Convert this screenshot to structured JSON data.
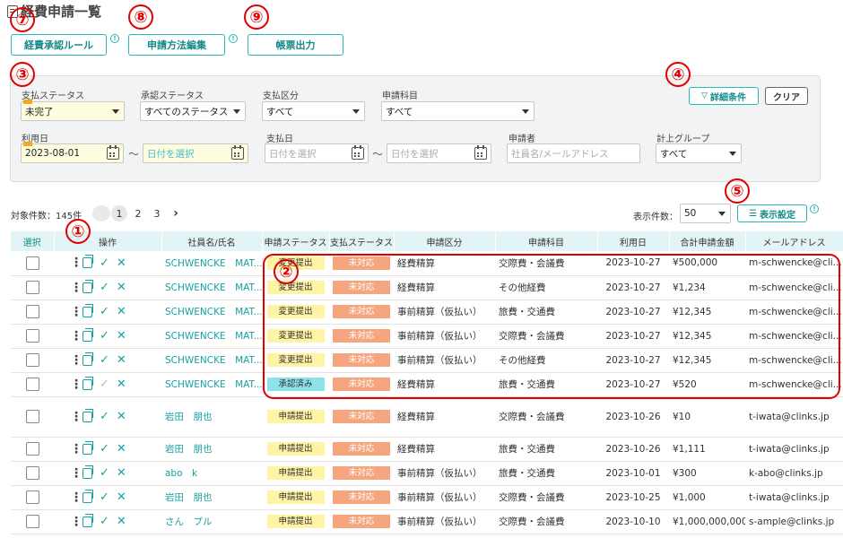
{
  "page": {
    "title": "経費申請一覧"
  },
  "toolbar": {
    "approval_rule": "経費承認ルール",
    "method_edit": "申請方法編集",
    "report_output": "帳票出力",
    "info": "!"
  },
  "callouts": [
    "①",
    "②",
    "③",
    "④",
    "⑤",
    "⑦",
    "⑧",
    "⑨"
  ],
  "filters": {
    "payment_status": {
      "label": "支払ステータス",
      "value": "未完了"
    },
    "approval_status": {
      "label": "承認ステータス",
      "value": "すべてのステータス"
    },
    "payment_type": {
      "label": "支払区分",
      "value": "すべて"
    },
    "item": {
      "label": "申請科目",
      "value": "すべて"
    },
    "use_date": {
      "label": "利用日",
      "from": "2023-08-01",
      "to_placeholder": "日付を選択"
    },
    "payment_date": {
      "label": "支払日",
      "from_placeholder": "日付を選択",
      "to_placeholder": "日付を選択"
    },
    "applicant": {
      "label": "申請者",
      "placeholder": "社員名/メールアドレス"
    },
    "group": {
      "label": "計上グループ",
      "value": "すべて"
    },
    "tilde": "～",
    "detail_button": "詳細条件",
    "clear_button": "クリア"
  },
  "list": {
    "count_text": "対象件数：145件",
    "pages": [
      "1",
      "2",
      "3"
    ],
    "next": "›",
    "page_size_label": "表示件数：",
    "page_size": "50",
    "display_settings": "表示設定"
  },
  "table": {
    "headers": [
      "選択",
      "操作",
      "社員名/氏名",
      "申請ステータス",
      "支払ステータス",
      "申請区分",
      "申請科目",
      "利用日",
      "合計申請金額",
      "メールアドレス"
    ],
    "rows": [
      {
        "name": "SCHWENCKE　MAT...",
        "status": "変更提出",
        "status_color": "y",
        "pay": "未対応",
        "type": "経費精算",
        "item": "交際費・会議費",
        "date": "2023-10-27",
        "amount": "¥500,000",
        "email": "m-schwencke@cli..."
      },
      {
        "name": "SCHWENCKE　MAT...",
        "status": "変更提出",
        "status_color": "y",
        "pay": "未対応",
        "type": "経費精算",
        "item": "その他経費",
        "date": "2023-10-27",
        "amount": "¥1,234",
        "email": "m-schwencke@cli..."
      },
      {
        "name": "SCHWENCKE　MAT...",
        "status": "変更提出",
        "status_color": "y",
        "pay": "未対応",
        "type": "事前精算（仮払い）",
        "item": "旅費・交通費",
        "date": "2023-10-27",
        "amount": "¥12,345",
        "email": "m-schwencke@cli..."
      },
      {
        "name": "SCHWENCKE　MAT...",
        "status": "変更提出",
        "status_color": "y",
        "pay": "未対応",
        "type": "事前精算（仮払い）",
        "item": "交際費・会議費",
        "date": "2023-10-27",
        "amount": "¥12,345",
        "email": "m-schwencke@cli..."
      },
      {
        "name": "SCHWENCKE　MAT...",
        "status": "変更提出",
        "status_color": "y",
        "pay": "未対応",
        "type": "事前精算（仮払い）",
        "item": "その他経費",
        "date": "2023-10-27",
        "amount": "¥12,345",
        "email": "m-schwencke@cli..."
      },
      {
        "name": "SCHWENCKE　MAT...",
        "status": "承認済み",
        "status_color": "c",
        "pay": "未対応",
        "type": "経費精算",
        "item": "旅費・交通費",
        "date": "2023-10-27",
        "amount": "¥520",
        "email": "m-schwencke@cli..."
      },
      {
        "name": "岩田　朋也",
        "status": "申請提出",
        "status_color": "y",
        "pay": "未対応",
        "type": "経費精算",
        "item": "交際費・会議費",
        "date": "2023-10-26",
        "amount": "¥10",
        "email": "t-iwata@clinks.jp"
      },
      {
        "name": "岩田　朋也",
        "status": "申請提出",
        "status_color": "y",
        "pay": "未対応",
        "type": "経費精算",
        "item": "旅費・交通費",
        "date": "2023-10-26",
        "amount": "¥1,111",
        "email": "t-iwata@clinks.jp"
      },
      {
        "name": "abo　k",
        "status": "申請提出",
        "status_color": "y",
        "pay": "未対応",
        "type": "事前精算（仮払い）",
        "item": "旅費・交通費",
        "date": "2023-10-01",
        "amount": "¥300",
        "email": "k-abo@clinks.jp"
      },
      {
        "name": "岩田　朋也",
        "status": "申請提出",
        "status_color": "y",
        "pay": "未対応",
        "type": "事前精算（仮払い）",
        "item": "交際費・会議費",
        "date": "2023-10-25",
        "amount": "¥1,000",
        "email": "t-iwata@clinks.jp"
      },
      {
        "name": "さん　プル",
        "status": "申請提出",
        "status_color": "y",
        "pay": "未対応",
        "type": "事前精算（仮払い）",
        "item": "交際費・会議費",
        "date": "2023-10-10",
        "amount": "¥1,000,000,000",
        "email": "s-ample@clinks.jp"
      }
    ]
  }
}
